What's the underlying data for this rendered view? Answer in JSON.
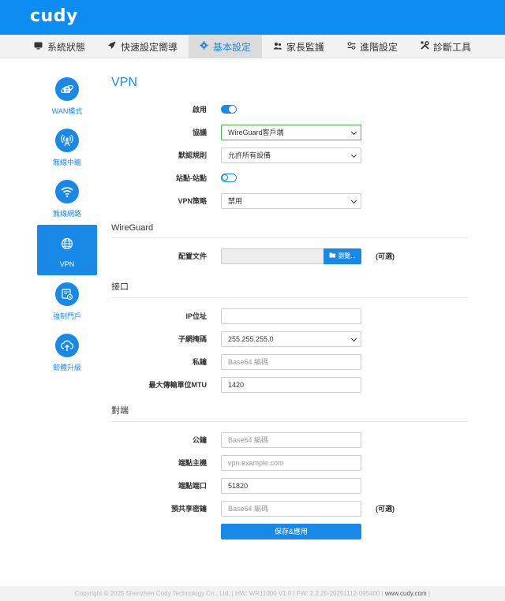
{
  "brand": "cudy",
  "nav": [
    {
      "label": "系統狀態",
      "icon": "monitor-icon",
      "active": false
    },
    {
      "label": "快速設定嚮導",
      "icon": "rocket-icon",
      "active": false
    },
    {
      "label": "基本設定",
      "icon": "gear-icon",
      "active": true
    },
    {
      "label": "家長監護",
      "icon": "users-icon",
      "active": false
    },
    {
      "label": "進階設定",
      "icon": "sliders-icon",
      "active": false
    },
    {
      "label": "診斷工具",
      "icon": "tools-icon",
      "active": false
    }
  ],
  "sidebar": [
    {
      "label": "WAN模式",
      "icon": "internet-explorer-icon",
      "active": false
    },
    {
      "label": "無線中繼",
      "icon": "wireless-repeater-icon",
      "active": false
    },
    {
      "label": "無線網路",
      "icon": "wifi-icon",
      "active": false
    },
    {
      "label": "VPN",
      "icon": "globe-icon",
      "active": true
    },
    {
      "label": "強制門戶",
      "icon": "captive-portal-icon",
      "active": false
    },
    {
      "label": "韌體升級",
      "icon": "cloud-upload-icon",
      "active": false
    }
  ],
  "page": {
    "title": "VPN",
    "enable_label": "啟用",
    "enable_on": true,
    "protocol_label": "協議",
    "protocol_value": "WireGuard客戶端",
    "default_rule_label": "默認規則",
    "default_rule_value": "允許所有設備",
    "site_to_site_label": "站點-站點",
    "site_to_site_on": false,
    "vpn_policy_label": "VPN策略",
    "vpn_policy_value": "禁用"
  },
  "wireguard": {
    "title": "WireGuard",
    "config_label": "配置文件",
    "browse_label": "瀏覽...",
    "optional": "(可選)"
  },
  "interface": {
    "title": "接口",
    "ip_label": "IP位址",
    "ip_value": "",
    "mask_label": "子網掩碼",
    "mask_value": "255.255.255.0",
    "private_key_label": "私鑰",
    "private_key_placeholder": "Base64 編碼",
    "mtu_label": "最大傳輸單位MTU",
    "mtu_value": "1420"
  },
  "peer": {
    "title": "對端",
    "public_key_label": "公鑰",
    "public_key_placeholder": "Base64 編碼",
    "endpoint_host_label": "端點主機",
    "endpoint_host_placeholder": "vpn.example.com",
    "endpoint_port_label": "端點端口",
    "endpoint_port_value": "51820",
    "psk_label": "預共享密鑰",
    "psk_placeholder": "Base64 編碼",
    "optional": "(可選)",
    "save_label": "保存&應用"
  },
  "footer": {
    "copyright": "Copyright © 2025 Shenzhen Cudy Technology Co., Ltd.",
    "hw": "HW: WR11000 V1.0",
    "fw": "FW: 2.2.25-20251112-095400",
    "site": "www.cudy.com"
  },
  "colors": {
    "primary": "#1989e8",
    "header": "#0d8df2"
  }
}
